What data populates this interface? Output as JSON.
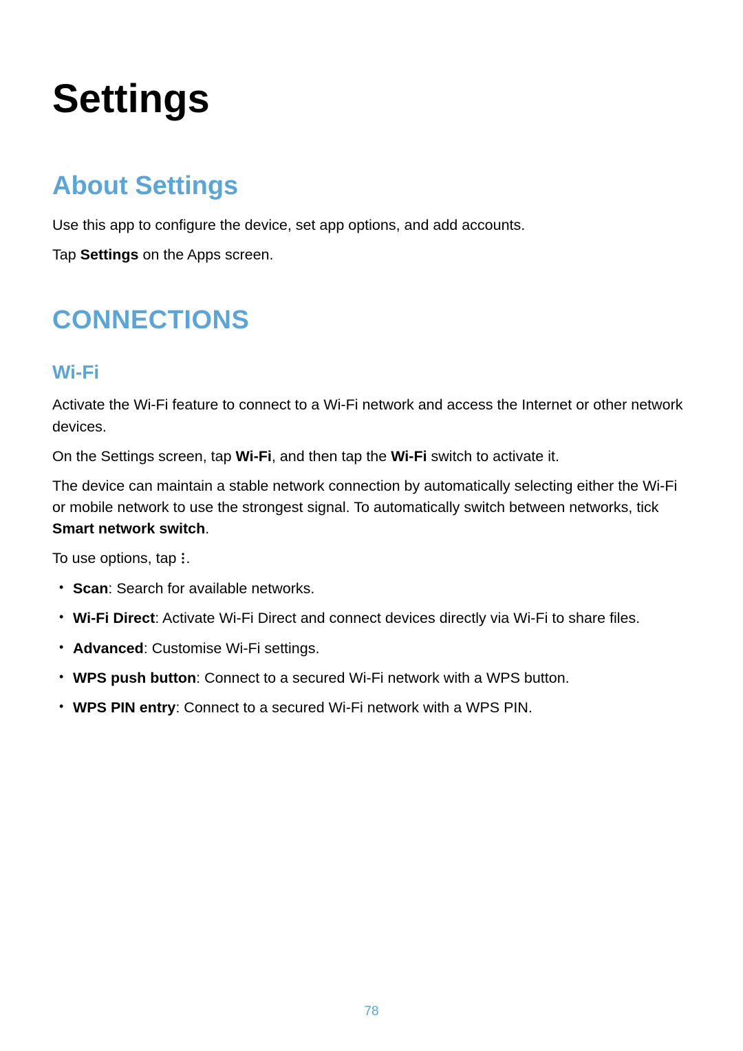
{
  "page": {
    "title": "Settings",
    "number": "78"
  },
  "about": {
    "heading": "About Settings",
    "intro": "Use this app to configure the device, set app options, and add accounts.",
    "tap_prefix": "Tap ",
    "tap_bold": "Settings",
    "tap_suffix": " on the Apps screen."
  },
  "connections": {
    "heading": "CONNECTIONS",
    "wifi": {
      "heading": "Wi-Fi",
      "desc1": "Activate the Wi-Fi feature to connect to a Wi-Fi network and access the Internet or other network devices.",
      "desc2_part1": "On the Settings screen, tap ",
      "desc2_bold1": "Wi-Fi",
      "desc2_part2": ", and then tap the ",
      "desc2_bold2": "Wi-Fi",
      "desc2_part3": " switch to activate it.",
      "desc3_part1": "The device can maintain a stable network connection by automatically selecting either the Wi-Fi or mobile network to use the strongest signal. To automatically switch between networks, tick ",
      "desc3_bold": "Smart network switch",
      "desc3_part2": ".",
      "options_prefix": "To use options, tap ",
      "options_suffix": ".",
      "options_icon_name": "more-options-icon",
      "items": [
        {
          "bold": "Scan",
          "rest": ": Search for available networks."
        },
        {
          "bold": "Wi-Fi Direct",
          "rest": ": Activate Wi-Fi Direct and connect devices directly via Wi-Fi to share files."
        },
        {
          "bold": "Advanced",
          "rest": ": Customise Wi-Fi settings."
        },
        {
          "bold": "WPS push button",
          "rest": ": Connect to a secured Wi-Fi network with a WPS button."
        },
        {
          "bold": "WPS PIN entry",
          "rest": ": Connect to a secured Wi-Fi network with a WPS PIN."
        }
      ]
    }
  }
}
